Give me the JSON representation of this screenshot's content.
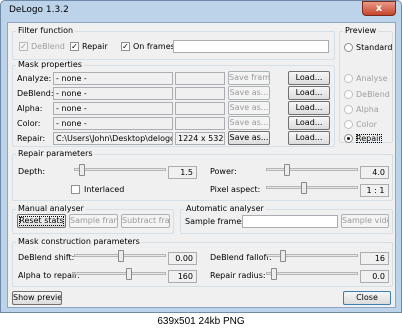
{
  "window": {
    "title": "DeLogo 1.3.2",
    "close_glyph": "x"
  },
  "filter_function": {
    "title": "Filter function",
    "items": [
      {
        "label": "DeBlend",
        "checked": true,
        "enabled": false
      },
      {
        "label": "Repair",
        "checked": true,
        "enabled": true
      },
      {
        "label": "On frames:",
        "checked": true,
        "enabled": true
      }
    ],
    "frames_value": ""
  },
  "preview": {
    "title": "Preview",
    "options": [
      {
        "label": "Standard",
        "selected": false,
        "enabled": true
      },
      {
        "label": "Analyse",
        "selected": false,
        "enabled": false
      },
      {
        "label": "DeBlend",
        "selected": false,
        "enabled": false
      },
      {
        "label": "Alpha",
        "selected": false,
        "enabled": false
      },
      {
        "label": "Color",
        "selected": false,
        "enabled": false
      },
      {
        "label": "Repair",
        "selected": true,
        "enabled": true
      }
    ]
  },
  "mask_properties": {
    "title": "Mask properties",
    "rows": [
      {
        "label": "Analyze:",
        "value": "- none -",
        "size": "",
        "save": "Save frame",
        "load": "Load..."
      },
      {
        "label": "DeBlend:",
        "value": "- none -",
        "size": "",
        "save": "Save as...",
        "load": "Load..."
      },
      {
        "label": "Alpha:",
        "value": "- none -",
        "size": "",
        "save": "Save as...",
        "load": "Load..."
      },
      {
        "label": "Color:",
        "value": "- none -",
        "size": "",
        "save": "Save as...",
        "load": "Load..."
      },
      {
        "label": "Repair:",
        "value": "C:\\Users\\John\\Desktop\\delogo\\delogo",
        "size": "1224 x 532",
        "save": "Save as...",
        "load": "Load..."
      }
    ]
  },
  "repair_parameters": {
    "title": "Repair parameters",
    "depth": {
      "label": "Depth:",
      "value": "1.5",
      "level": 0.05
    },
    "interlaced": {
      "label": "Interlaced",
      "checked": false
    },
    "power": {
      "label": "Power:",
      "value": "4.0",
      "level": 0.2
    },
    "pixel_aspect": {
      "label": "Pixel aspect:",
      "value": "1 : 1",
      "level": 0.4
    }
  },
  "manual_analyser": {
    "title": "Manual analyser",
    "reset": "Reset stats",
    "sample": "Sample frame",
    "subtract": "Subtract frame"
  },
  "automatic_analyser": {
    "title": "Automatic analyser",
    "frames_label": "Sample frames:",
    "frames_value": "",
    "sample_video": "Sample video"
  },
  "mask_construction": {
    "title": "Mask construction parameters",
    "deblend_shift": {
      "label": "DeBlend shift:",
      "value": "0.00",
      "level": 0.5
    },
    "alpha_to_repair": {
      "label": "Alpha to repair:",
      "value": "160",
      "level": 0.6
    },
    "deblend_falloff": {
      "label": "DeBlend falloff:",
      "value": "16",
      "level": 0.15
    },
    "repair_radius": {
      "label": "Repair radius:",
      "value": "0.0",
      "level": 0.05
    }
  },
  "bottom": {
    "show_preview": "Show preview",
    "close": "Close"
  },
  "caption": "639x501  24kb  PNG"
}
